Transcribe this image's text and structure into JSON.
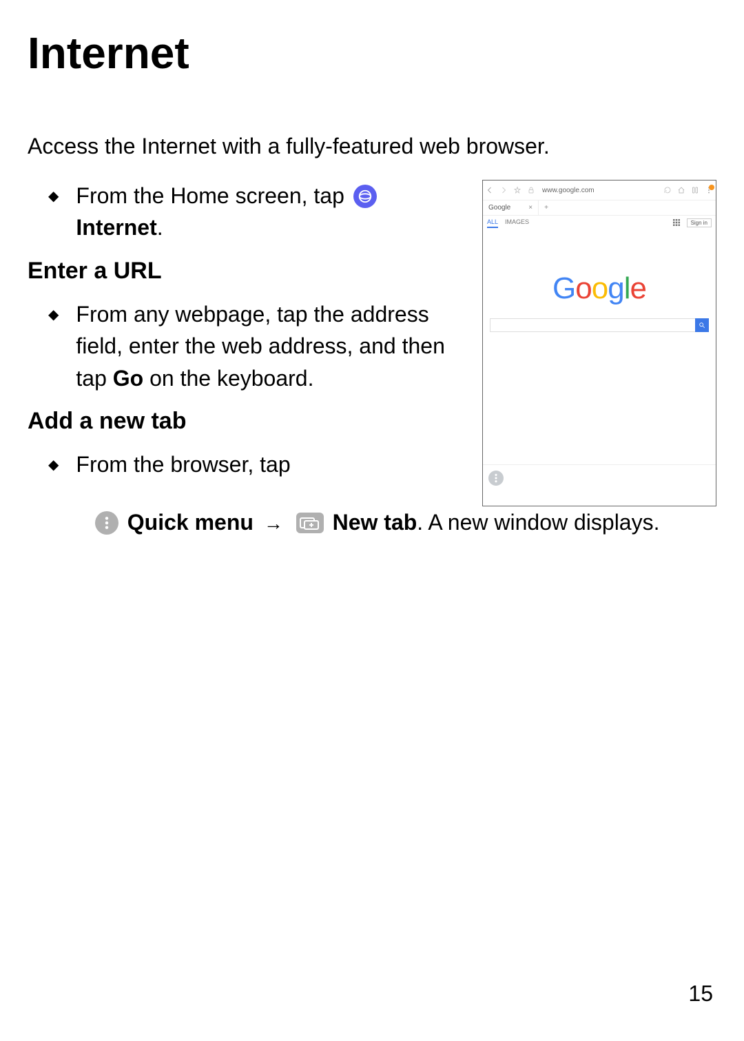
{
  "title": "Internet",
  "intro": "Access the Internet with a fully-featured web browser.",
  "bullet1_part1": "From the Home screen, tap ",
  "bullet1_label": "Internet",
  "bullet1_end": ".",
  "section1": "Enter a URL",
  "bullet2_part1": "From any webpage, tap the address field, enter the web address, and then tap ",
  "bullet2_bold": "Go",
  "bullet2_part2": " on the keyboard.",
  "section2": "Add a new tab",
  "bullet3_part1": "From the browser, tap",
  "bullet3_quickmenu": "Quick menu",
  "bullet3_arrow": "→",
  "bullet3_newtab": "New tab",
  "bullet3_end": ". A new window displays.",
  "page_number": "15",
  "screenshot": {
    "address": "www.google.com",
    "tab_label": "Google",
    "subnav_all": "ALL",
    "subnav_images": "IMAGES",
    "subnav_signin": "Sign in",
    "logo_letters": [
      "G",
      "o",
      "o",
      "g",
      "l",
      "e"
    ]
  }
}
